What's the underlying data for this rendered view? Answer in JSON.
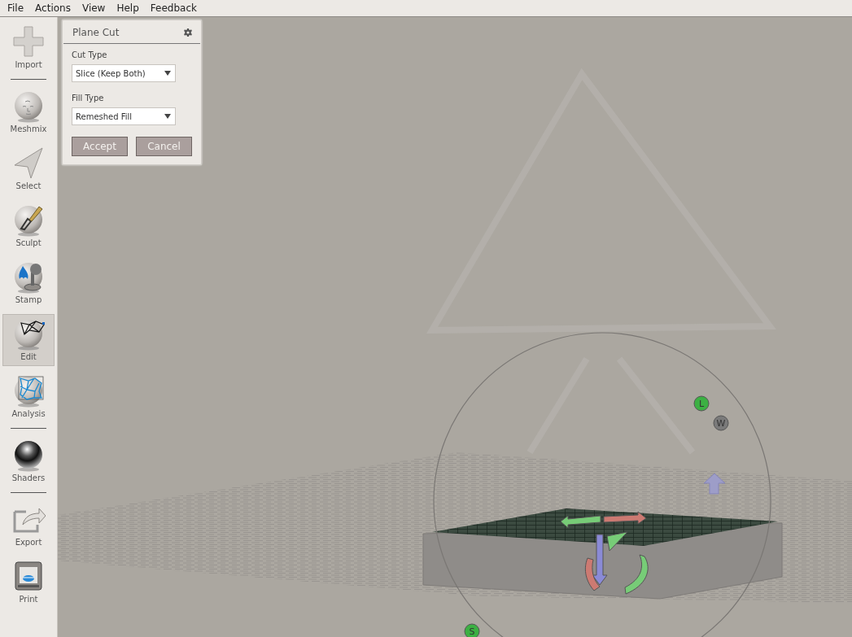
{
  "menu": [
    "File",
    "Actions",
    "View",
    "Help",
    "Feedback"
  ],
  "tool_groups": [
    [
      {
        "label": "Import",
        "selected": false
      }
    ],
    [
      {
        "label": "Meshmix",
        "selected": false
      },
      {
        "label": "Select",
        "selected": false
      },
      {
        "label": "Sculpt",
        "selected": false
      },
      {
        "label": "Stamp",
        "selected": false
      },
      {
        "label": "Edit",
        "selected": true
      },
      {
        "label": "Analysis",
        "selected": false
      }
    ],
    [
      {
        "label": "Shaders",
        "selected": false
      }
    ],
    [
      {
        "label": "Export",
        "selected": false
      },
      {
        "label": "Print",
        "selected": false
      }
    ]
  ],
  "panel": {
    "title": "Plane Cut",
    "fields": [
      {
        "label": "Cut Type",
        "value": "Slice (Keep Both)"
      },
      {
        "label": "Fill Type",
        "value": "Remeshed Fill"
      }
    ],
    "buttons": [
      "Accept",
      "Cancel"
    ]
  },
  "gizmo_handles": [
    {
      "label": "L",
      "color": "#3cb043"
    },
    {
      "label": "W",
      "color": "#7a7a7a"
    },
    {
      "label": "S",
      "color": "#3cb043"
    }
  ]
}
